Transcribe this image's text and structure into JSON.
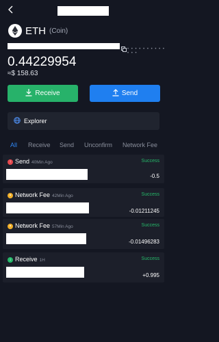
{
  "header": {
    "back_icon": "chevron-left-icon"
  },
  "coin": {
    "symbol": "ETH",
    "type": "(Coin)",
    "logo_icon": "ethereum-icon"
  },
  "wallet": {
    "balance": "0.44229954",
    "fiat_value": "≈$ 158.63"
  },
  "actions": {
    "receive_label": "Receive",
    "send_label": "Send",
    "receive_icon": "download-icon",
    "send_icon": "upload-icon"
  },
  "explorer": {
    "label": "Explorer",
    "icon": "globe-icon"
  },
  "tabs": [
    {
      "label": "All"
    },
    {
      "label": "Receive"
    },
    {
      "label": "Send"
    },
    {
      "label": "Unconfirm"
    },
    {
      "label": "Network Fee"
    }
  ],
  "transactions": [
    {
      "type": "Send",
      "time": "40Min Ago",
      "status": "Success",
      "amount": "-0.5",
      "icon": "send-icon",
      "icon_color": "#e5484d"
    },
    {
      "type": "Network Fee",
      "time": "42Min Ago",
      "status": "Success",
      "amount": "-0.01211245",
      "icon": "fee-icon",
      "icon_color": "#f2b02a"
    },
    {
      "type": "Network Fee",
      "time": "57Min Ago",
      "status": "Success",
      "amount": "-0.01496283",
      "icon": "fee-icon",
      "icon_color": "#f2b02a"
    },
    {
      "type": "Receive",
      "time": "1H",
      "status": "Success",
      "amount": "+0.995",
      "icon": "receive-icon",
      "icon_color": "#26b96a"
    }
  ],
  "colors": {
    "background": "#141722",
    "card": "#1c1f2a",
    "success": "#26b96a",
    "receive_button": "#27b26a",
    "send_button": "#1f7ff0",
    "active_tab": "#2f86f2"
  }
}
